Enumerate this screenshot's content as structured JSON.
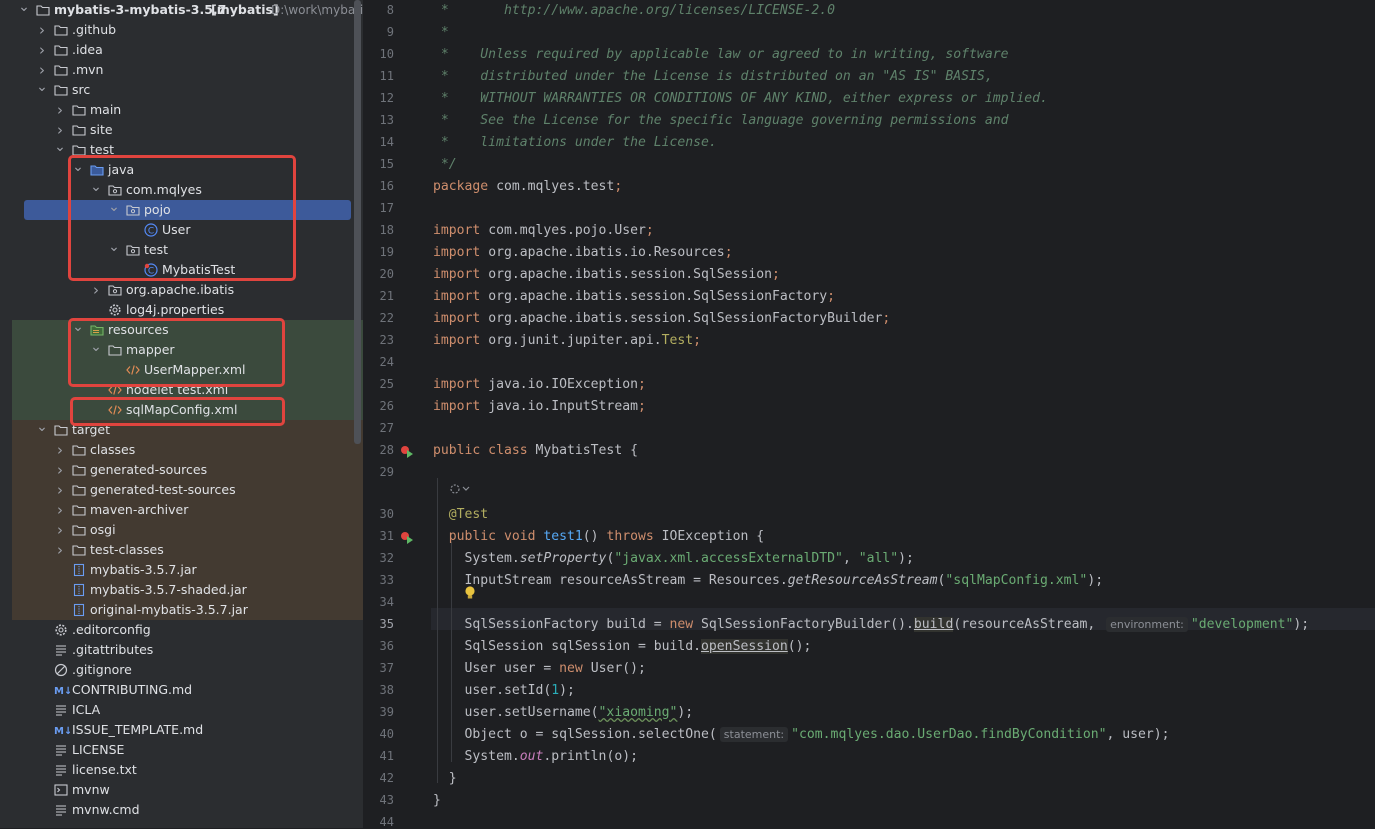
{
  "project": {
    "root_name": "mybatis-3-mybatis-3.5.7",
    "root_module": "[mybatis]",
    "root_path": "D:\\work\\mybatis-"
  },
  "tree": [
    {
      "label": "mybatis-3-mybatis-3.5.7",
      "depth": 0,
      "chev": "open",
      "icon": "folder-icon"
    },
    {
      "label": ".github",
      "depth": 1,
      "chev": "closed",
      "icon": "folder-icon"
    },
    {
      "label": ".idea",
      "depth": 1,
      "chev": "closed",
      "icon": "folder-icon"
    },
    {
      "label": ".mvn",
      "depth": 1,
      "chev": "closed",
      "icon": "folder-icon"
    },
    {
      "label": "src",
      "depth": 1,
      "chev": "open",
      "icon": "folder-icon"
    },
    {
      "label": "main",
      "depth": 2,
      "chev": "closed",
      "icon": "folder-icon"
    },
    {
      "label": "site",
      "depth": 2,
      "chev": "closed",
      "icon": "folder-icon"
    },
    {
      "label": "test",
      "depth": 2,
      "chev": "open",
      "icon": "folder-icon"
    },
    {
      "label": "java",
      "depth": 3,
      "chev": "open",
      "icon": "source-folder-icon"
    },
    {
      "label": "com.mqlyes",
      "depth": 4,
      "chev": "open",
      "icon": "package-icon"
    },
    {
      "label": "pojo",
      "depth": 5,
      "chev": "open",
      "icon": "package-icon"
    },
    {
      "label": "User",
      "depth": 6,
      "chev": "none",
      "icon": "class-icon"
    },
    {
      "label": "test",
      "depth": 5,
      "chev": "open",
      "icon": "package-icon"
    },
    {
      "label": "MybatisTest",
      "depth": 6,
      "chev": "none",
      "icon": "test-class-icon"
    },
    {
      "label": "org.apache.ibatis",
      "depth": 4,
      "chev": "closed",
      "icon": "package-icon"
    },
    {
      "label": "log4j.properties",
      "depth": 4,
      "chev": "none",
      "icon": "gear-icon"
    },
    {
      "label": "resources",
      "depth": 3,
      "chev": "open",
      "icon": "resources-folder-icon"
    },
    {
      "label": "mapper",
      "depth": 4,
      "chev": "open",
      "icon": "folder-icon"
    },
    {
      "label": "UserMapper.xml",
      "depth": 5,
      "chev": "none",
      "icon": "xml-icon"
    },
    {
      "label": "nodelet test.xml",
      "depth": 4,
      "chev": "none",
      "icon": "xml-icon"
    },
    {
      "label": "sqlMapConfig.xml",
      "depth": 4,
      "chev": "none",
      "icon": "xml-icon"
    },
    {
      "label": "target",
      "depth": 1,
      "chev": "open",
      "icon": "folder-icon"
    },
    {
      "label": "classes",
      "depth": 2,
      "chev": "closed",
      "icon": "folder-icon"
    },
    {
      "label": "generated-sources",
      "depth": 2,
      "chev": "closed",
      "icon": "folder-icon"
    },
    {
      "label": "generated-test-sources",
      "depth": 2,
      "chev": "closed",
      "icon": "folder-icon"
    },
    {
      "label": "maven-archiver",
      "depth": 2,
      "chev": "closed",
      "icon": "folder-icon"
    },
    {
      "label": "osgi",
      "depth": 2,
      "chev": "closed",
      "icon": "folder-icon"
    },
    {
      "label": "test-classes",
      "depth": 2,
      "chev": "closed",
      "icon": "folder-icon"
    },
    {
      "label": "mybatis-3.5.7.jar",
      "depth": 2,
      "chev": "none",
      "icon": "jar-icon"
    },
    {
      "label": "mybatis-3.5.7-shaded.jar",
      "depth": 2,
      "chev": "none",
      "icon": "jar-icon"
    },
    {
      "label": "original-mybatis-3.5.7.jar",
      "depth": 2,
      "chev": "none",
      "icon": "jar-icon"
    },
    {
      "label": ".editorconfig",
      "depth": 1,
      "chev": "none",
      "icon": "gear-icon"
    },
    {
      "label": ".gitattributes",
      "depth": 1,
      "chev": "none",
      "icon": "text-icon"
    },
    {
      "label": ".gitignore",
      "depth": 1,
      "chev": "none",
      "icon": "ignore-icon"
    },
    {
      "label": "CONTRIBUTING.md",
      "depth": 1,
      "chev": "none",
      "icon": "markdown-icon"
    },
    {
      "label": "ICLA",
      "depth": 1,
      "chev": "none",
      "icon": "text-icon"
    },
    {
      "label": "ISSUE_TEMPLATE.md",
      "depth": 1,
      "chev": "none",
      "icon": "markdown-icon"
    },
    {
      "label": "LICENSE",
      "depth": 1,
      "chev": "none",
      "icon": "text-icon"
    },
    {
      "label": "license.txt",
      "depth": 1,
      "chev": "none",
      "icon": "text-icon"
    },
    {
      "label": "mvnw",
      "depth": 1,
      "chev": "none",
      "icon": "terminal-icon"
    },
    {
      "label": "mvnw.cmd",
      "depth": 1,
      "chev": "none",
      "icon": "text-icon"
    }
  ],
  "editor": {
    "current_line": "35",
    "lines": [
      {
        "n": "8",
        "parts": [
          [
            "cm",
            " *       http://www.apache.org/licenses/LICENSE-2.0"
          ]
        ]
      },
      {
        "n": "9",
        "parts": [
          [
            "cm",
            " *"
          ]
        ]
      },
      {
        "n": "10",
        "parts": [
          [
            "cm",
            " *    Unless required by applicable law or agreed to in writing, software"
          ]
        ]
      },
      {
        "n": "11",
        "parts": [
          [
            "cm",
            " *    distributed under the License is distributed on an \"AS IS\" BASIS,"
          ]
        ]
      },
      {
        "n": "12",
        "parts": [
          [
            "cm",
            " *    WITHOUT WARRANTIES OR CONDITIONS OF ANY KIND, either express or implied."
          ]
        ]
      },
      {
        "n": "13",
        "parts": [
          [
            "cm",
            " *    See the License for the specific language governing permissions and"
          ]
        ]
      },
      {
        "n": "14",
        "parts": [
          [
            "cm",
            " *    limitations under the License."
          ]
        ]
      },
      {
        "n": "15",
        "parts": [
          [
            "cm",
            " */"
          ]
        ]
      },
      {
        "n": "16",
        "parts": [
          [
            "kw",
            "package "
          ],
          [
            "",
            "com.mqlyes.test"
          ],
          [
            "kw",
            ";"
          ]
        ]
      },
      {
        "n": "17",
        "parts": []
      },
      {
        "n": "18",
        "parts": [
          [
            "kw",
            "import "
          ],
          [
            "",
            "com.mqlyes.pojo.User"
          ],
          [
            "kw",
            ";"
          ]
        ]
      },
      {
        "n": "19",
        "parts": [
          [
            "kw",
            "import "
          ],
          [
            "",
            "org.apache.ibatis.io.Resources"
          ],
          [
            "kw",
            ";"
          ]
        ]
      },
      {
        "n": "20",
        "parts": [
          [
            "kw",
            "import "
          ],
          [
            "",
            "org.apache.ibatis.session.SqlSession"
          ],
          [
            "kw",
            ";"
          ]
        ]
      },
      {
        "n": "21",
        "parts": [
          [
            "kw",
            "import "
          ],
          [
            "",
            "org.apache.ibatis.session.SqlSessionFactory"
          ],
          [
            "kw",
            ";"
          ]
        ]
      },
      {
        "n": "22",
        "parts": [
          [
            "kw",
            "import "
          ],
          [
            "",
            "org.apache.ibatis.session.SqlSessionFactoryBuilder"
          ],
          [
            "kw",
            ";"
          ]
        ]
      },
      {
        "n": "23",
        "parts": [
          [
            "kw",
            "import "
          ],
          [
            "",
            "org.junit.jupiter.api."
          ],
          [
            "ann",
            "Test"
          ],
          [
            "kw",
            ";"
          ]
        ]
      },
      {
        "n": "24",
        "parts": []
      },
      {
        "n": "25",
        "parts": [
          [
            "kw",
            "import "
          ],
          [
            "",
            "java.io.IOException"
          ],
          [
            "kw",
            ";"
          ]
        ]
      },
      {
        "n": "26",
        "parts": [
          [
            "kw",
            "import "
          ],
          [
            "",
            "java.io.InputStream"
          ],
          [
            "kw",
            ";"
          ]
        ]
      },
      {
        "n": "27",
        "parts": []
      },
      {
        "n": "28",
        "parts": [
          [
            "kw",
            "public class "
          ],
          [
            "",
            "MybatisTest {"
          ]
        ]
      },
      {
        "n": "29",
        "parts": []
      },
      {
        "n": "30",
        "parts": [
          [
            "ann",
            "  @Test"
          ]
        ]
      },
      {
        "n": "31",
        "parts": [
          [
            "kw",
            "  public void "
          ],
          [
            "mth",
            "test1"
          ],
          [
            "",
            "() "
          ],
          [
            "kw",
            "throws "
          ],
          [
            "",
            "IOException {"
          ]
        ]
      },
      {
        "n": "32",
        "parts": [
          [
            "",
            "    System."
          ],
          [
            "ital",
            "setProperty"
          ],
          [
            "",
            "("
          ],
          [
            "str",
            "\"javax.xml.accessExternalDTD\""
          ],
          [
            "",
            ", "
          ],
          [
            "str",
            "\"all\""
          ],
          [
            "",
            ");"
          ]
        ]
      },
      {
        "n": "33",
        "parts": [
          [
            "",
            "    InputStream resourceAsStream = Resources."
          ],
          [
            "ital",
            "getResourceAsStream"
          ],
          [
            "",
            "("
          ],
          [
            "str",
            "\"sqlMapConfig.xml\""
          ],
          [
            "",
            ");"
          ]
        ]
      },
      {
        "n": "34",
        "parts": []
      },
      {
        "n": "35",
        "parts": [
          [
            "",
            "    SqlSessionFactory build = "
          ],
          [
            "kw",
            "new "
          ],
          [
            "",
            "SqlSessionFactoryBuilder()."
          ],
          [
            "und",
            "build"
          ],
          [
            "",
            "(resourceAsStream, "
          ],
          [
            "hint",
            "environment:"
          ],
          [
            "str",
            "\"development\""
          ],
          [
            "",
            ");"
          ]
        ]
      },
      {
        "n": "36",
        "parts": [
          [
            "",
            "    SqlSession sqlSession = build."
          ],
          [
            "und",
            "openSession"
          ],
          [
            "",
            "();"
          ]
        ]
      },
      {
        "n": "37",
        "parts": [
          [
            "",
            "    User user = "
          ],
          [
            "kw",
            "new "
          ],
          [
            "",
            "User();"
          ]
        ]
      },
      {
        "n": "38",
        "parts": [
          [
            "",
            "    user.setId("
          ],
          [
            "num",
            "1"
          ],
          [
            "",
            ");"
          ]
        ]
      },
      {
        "n": "39",
        "parts": [
          [
            "",
            "    user.setUsername("
          ],
          [
            "strw",
            "\"xiaoming\""
          ],
          [
            "",
            ");"
          ]
        ]
      },
      {
        "n": "40",
        "parts": [
          [
            "",
            "    Object o = sqlSession.selectOne("
          ],
          [
            "hint",
            "statement:"
          ],
          [
            "str",
            "\"com.mqlyes.dao.UserDao.findByCondition\""
          ],
          [
            "",
            ", user);"
          ]
        ]
      },
      {
        "n": "41",
        "parts": [
          [
            "",
            "    System."
          ],
          [
            "fld",
            "out"
          ],
          [
            "",
            ".println(o);"
          ]
        ]
      },
      {
        "n": "42",
        "parts": [
          [
            "",
            "  }"
          ]
        ]
      },
      {
        "n": "43",
        "parts": [
          [
            "",
            "}"
          ]
        ]
      },
      {
        "n": "44",
        "parts": []
      }
    ]
  },
  "colors": {
    "selection": "#3d5a9a",
    "annotation_red": "#e0443e",
    "keyword": "#cf8e6d",
    "string": "#6aab73",
    "comment": "#5f826b"
  }
}
